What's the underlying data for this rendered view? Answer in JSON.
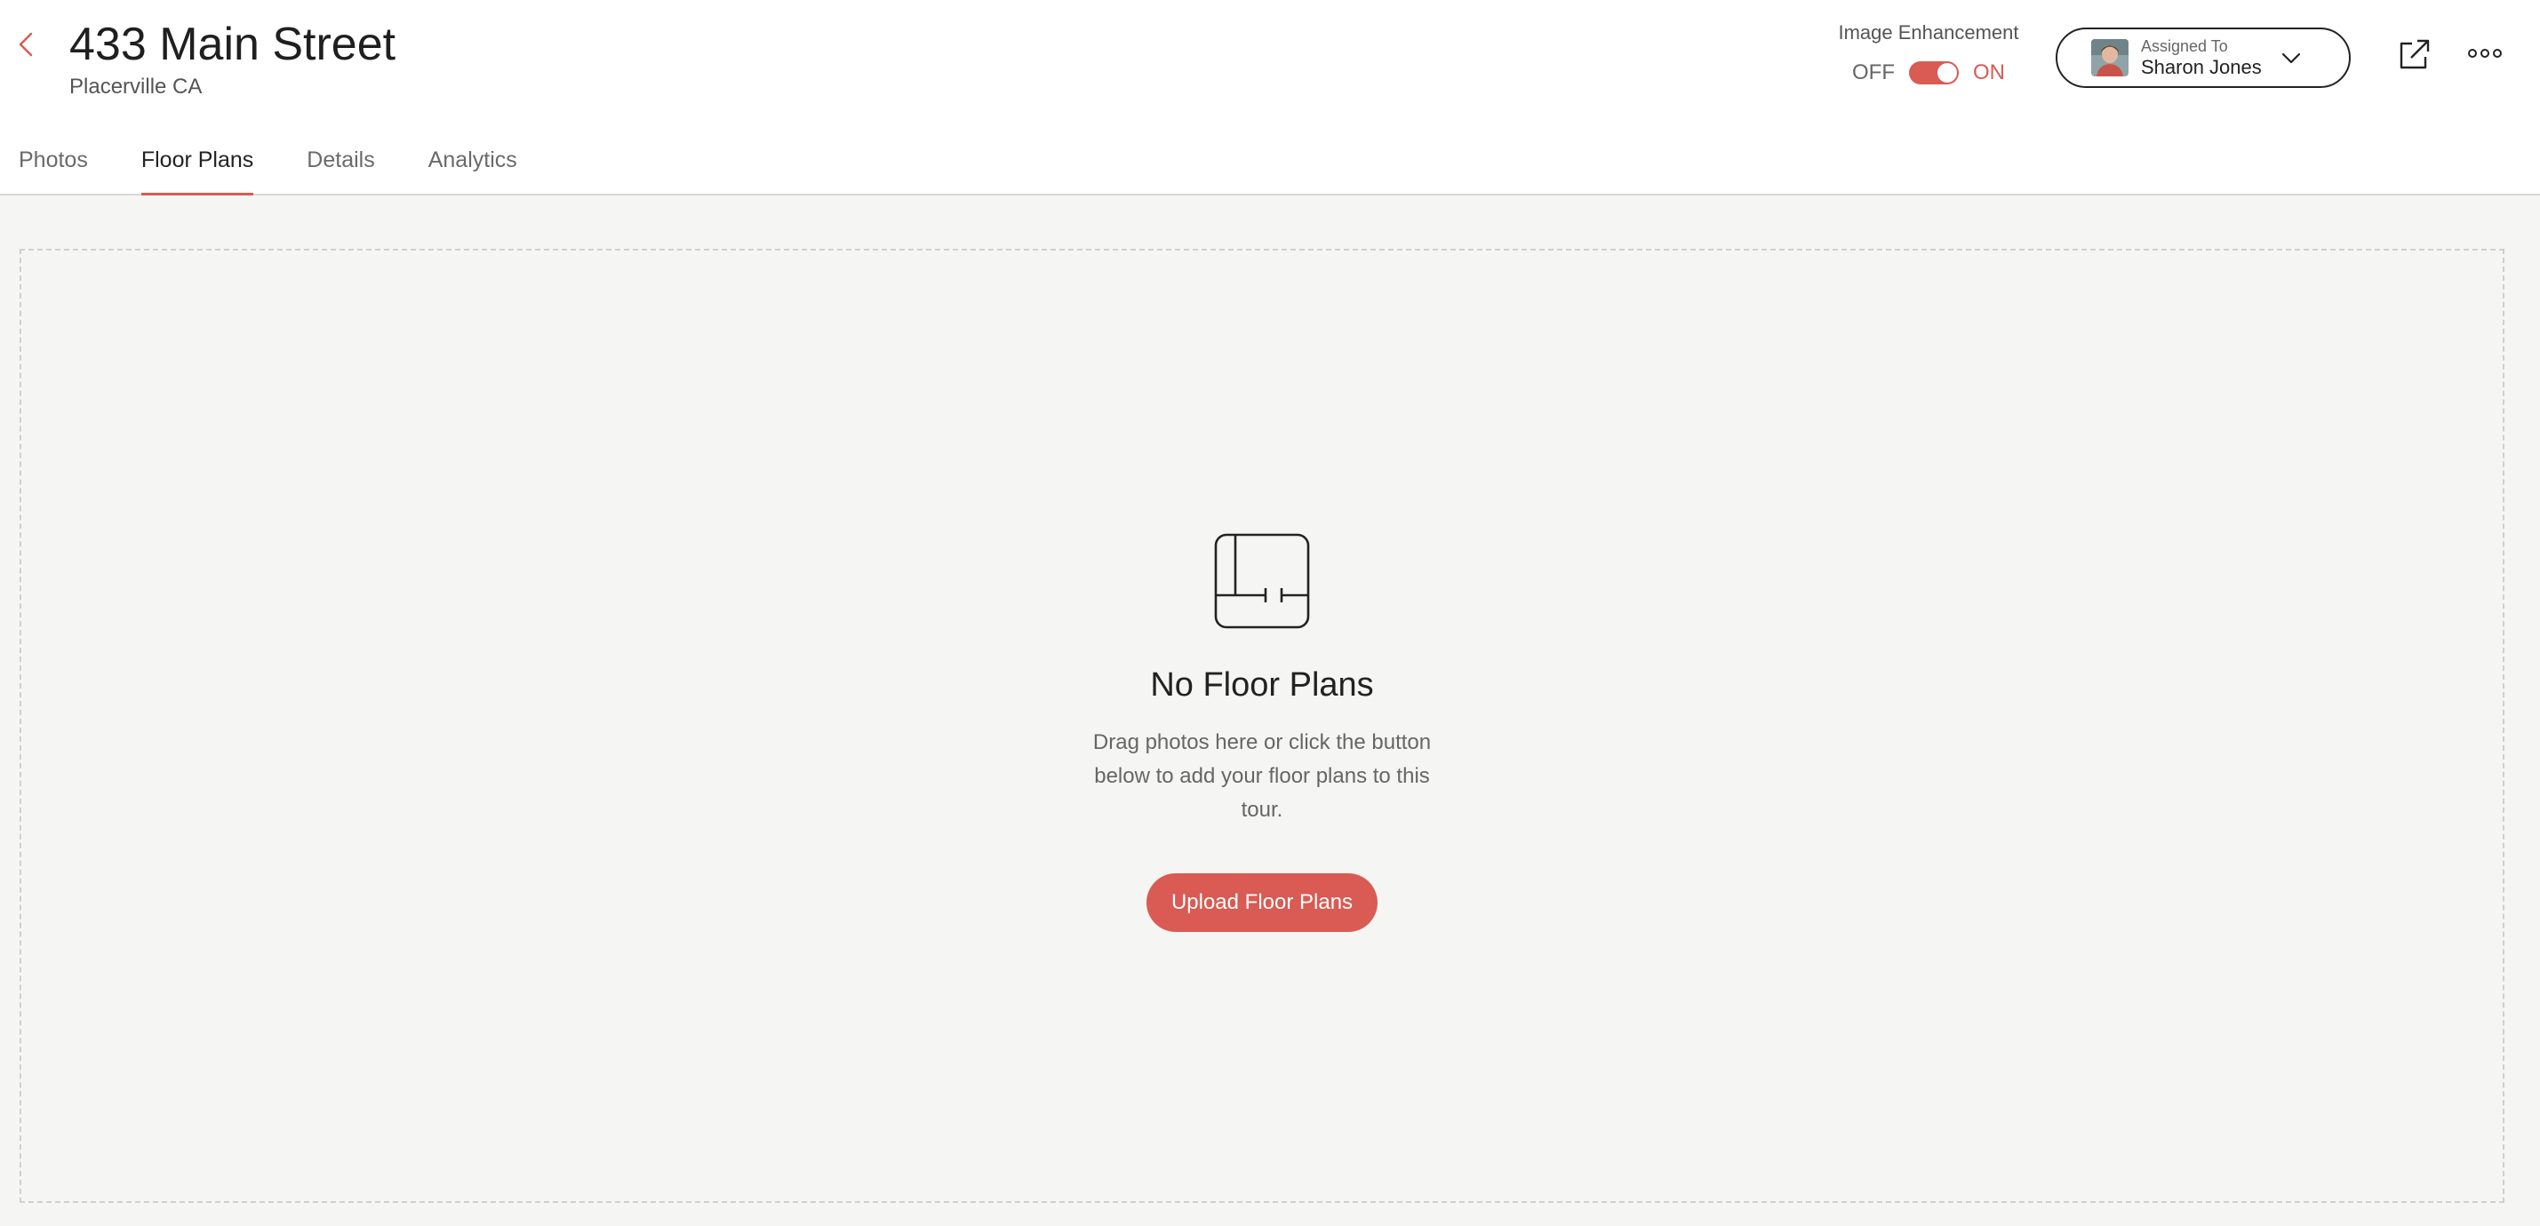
{
  "header": {
    "title": "433 Main Street",
    "subtitle": "Placerville CA",
    "back_icon": "chevron-left-icon"
  },
  "image_enhancement": {
    "label": "Image Enhancement",
    "off_label": "OFF",
    "on_label": "ON",
    "enabled": true
  },
  "assignee": {
    "caption": "Assigned To",
    "name": "Sharon Jones",
    "avatar_icon": "avatar"
  },
  "actions": {
    "external_link_icon": "external-link-icon",
    "more_icon": "more-horizontal-icon"
  },
  "tabs": [
    {
      "label": "Photos",
      "active": false
    },
    {
      "label": "Floor Plans",
      "active": true
    },
    {
      "label": "Details",
      "active": false
    },
    {
      "label": "Analytics",
      "active": false
    }
  ],
  "empty_state": {
    "icon": "floor-plan-icon",
    "title": "No Floor Plans",
    "description": "Drag photos here or click the button below to add your floor plans to this tour.",
    "button_label": "Upload Floor Plans"
  },
  "colors": {
    "accent": "#d95b53",
    "background": "#f5f5f3",
    "header_bg": "#ffffff"
  }
}
